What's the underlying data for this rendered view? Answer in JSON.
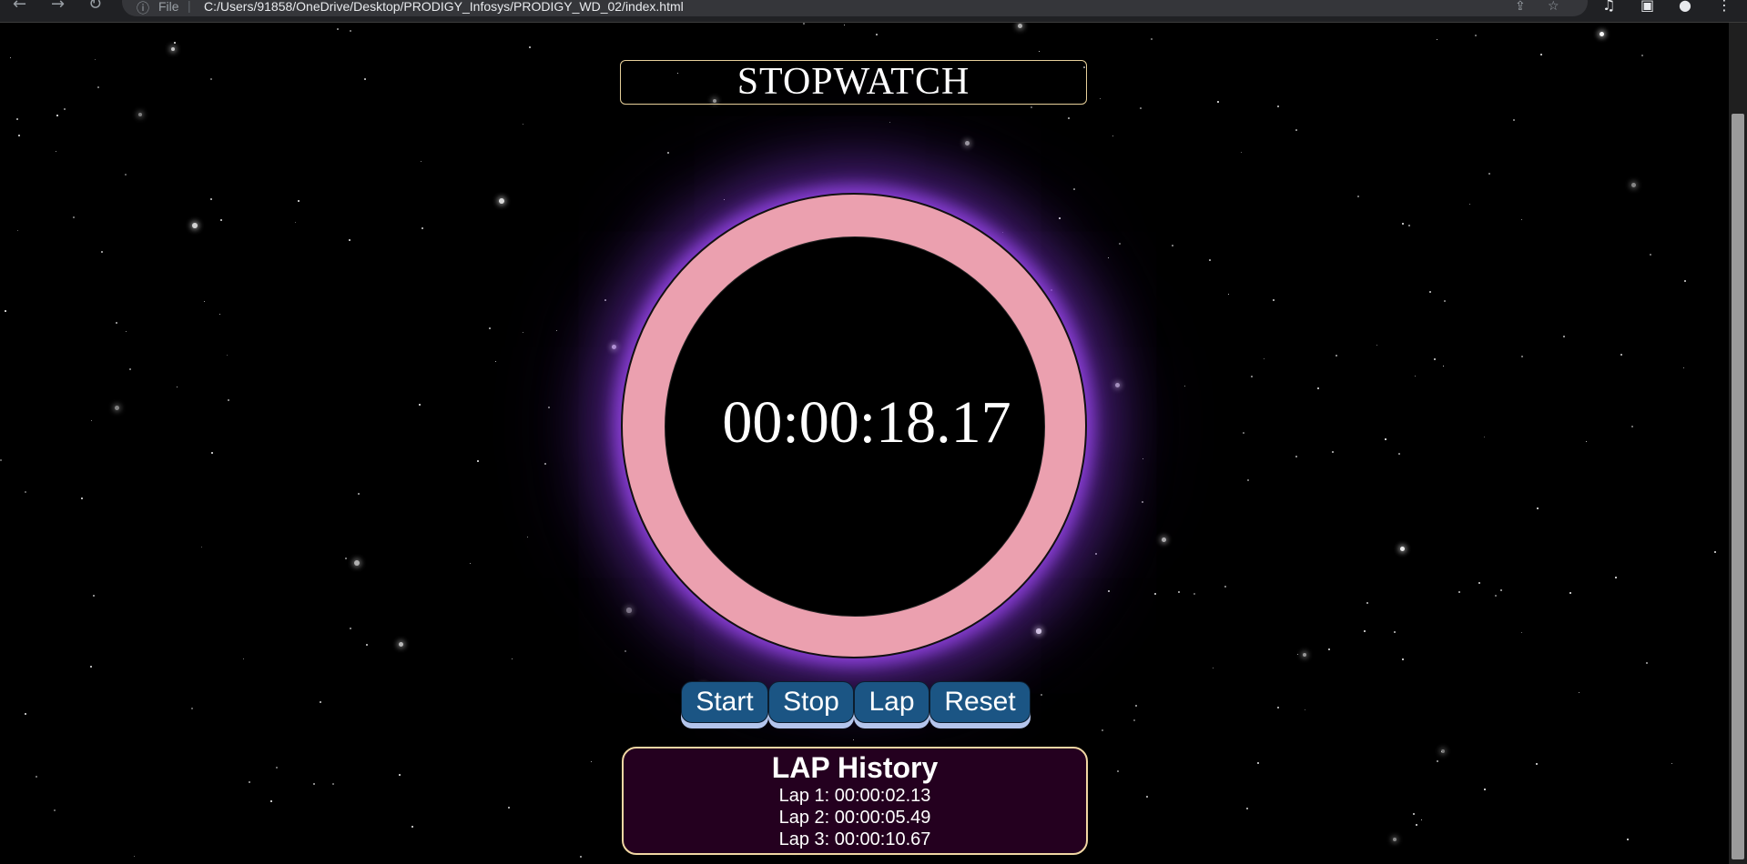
{
  "browser": {
    "info_icon": "info-circle-icon",
    "file_label": "File",
    "url": "C:/Users/91858/OneDrive/Desktop/PRODIGY_Infosys/PRODIGY_WD_02/index.html"
  },
  "page": {
    "title": "STOPWATCH",
    "time": "00:00:18.17",
    "buttons": {
      "start": "Start",
      "stop": "Stop",
      "lap": "Lap",
      "reset": "Reset"
    },
    "lap_history": {
      "title": "LAP History",
      "laps": [
        "Lap 1: 00:00:02.13",
        "Lap 2: 00:00:05.49",
        "Lap 3: 00:00:10.67"
      ]
    }
  },
  "colors": {
    "ring": "#eba0af",
    "glow": "#8a3fd6",
    "button": "#1b5584",
    "lap_bg": "#24001f",
    "title_border": "#e6cf9a"
  }
}
